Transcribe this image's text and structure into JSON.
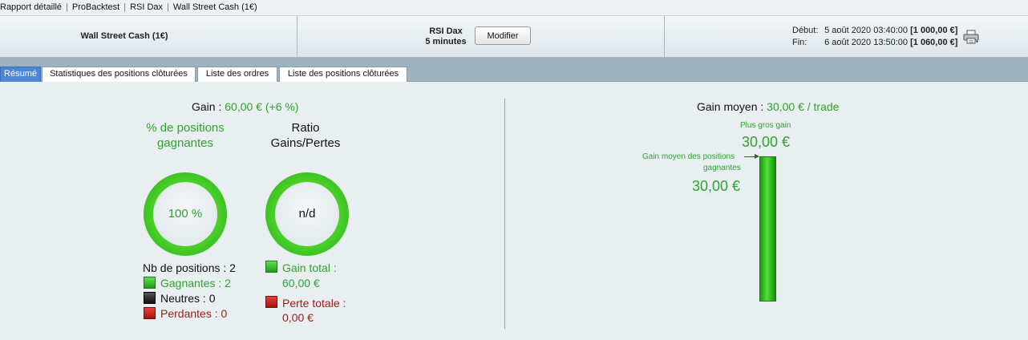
{
  "breadcrumb": [
    "Rapport détaillé",
    "ProBacktest",
    "RSI Dax",
    "Wall Street Cash (1€)"
  ],
  "header": {
    "instrument": "Wall Street Cash (1€)",
    "strategy_name": "RSI Dax",
    "timeframe": "5 minutes",
    "modify_label": "Modifier",
    "start_label": "Début:",
    "start_date": "5 août 2020 03:40:00",
    "start_value": "[1 000,00 €]",
    "end_label": "Fin:",
    "end_date": "6 août 2020 13:50:00",
    "end_value": "[1 060,00 €]",
    "print_icon": "printer-icon"
  },
  "tabs": [
    {
      "label": "Résumé",
      "active": true
    },
    {
      "label": "Statistiques des positions clôturées",
      "active": false
    },
    {
      "label": "Liste des ordres",
      "active": false
    },
    {
      "label": "Liste des positions clôturées",
      "active": false
    }
  ],
  "summary": {
    "gain_label": "Gain : ",
    "gain_value": "60,00 € (+6 %)",
    "pct_winning_label": "% de positions gagnantes",
    "pct_winning_value": "100 %",
    "ratio_label": "Ratio Gains/Pertes",
    "ratio_value": "n/d",
    "nb_positions": "Nb de positions : 2",
    "winners": "Gagnantes : 2",
    "neutral": "Neutres : 0",
    "losers": "Perdantes : 0",
    "total_gain_label": "Gain total :",
    "total_gain_value": "60,00 €",
    "total_loss_label": "Perte totale :",
    "total_loss_value": "0,00 €"
  },
  "average": {
    "label": "Gain moyen : ",
    "value": "30,00 € / trade",
    "biggest_gain_label": "Plus gros gain",
    "biggest_gain_value": "30,00 €",
    "avg_winning_label_1": "Gain moyen des positions",
    "avg_winning_label_2": "gagnantes",
    "avg_winning_value": "30,00 €"
  },
  "colors": {
    "gain": "#2ea32e",
    "loss": "#9b1c1c",
    "active_tab": "#4d86d4",
    "tab_bar": "#9db3bf"
  }
}
